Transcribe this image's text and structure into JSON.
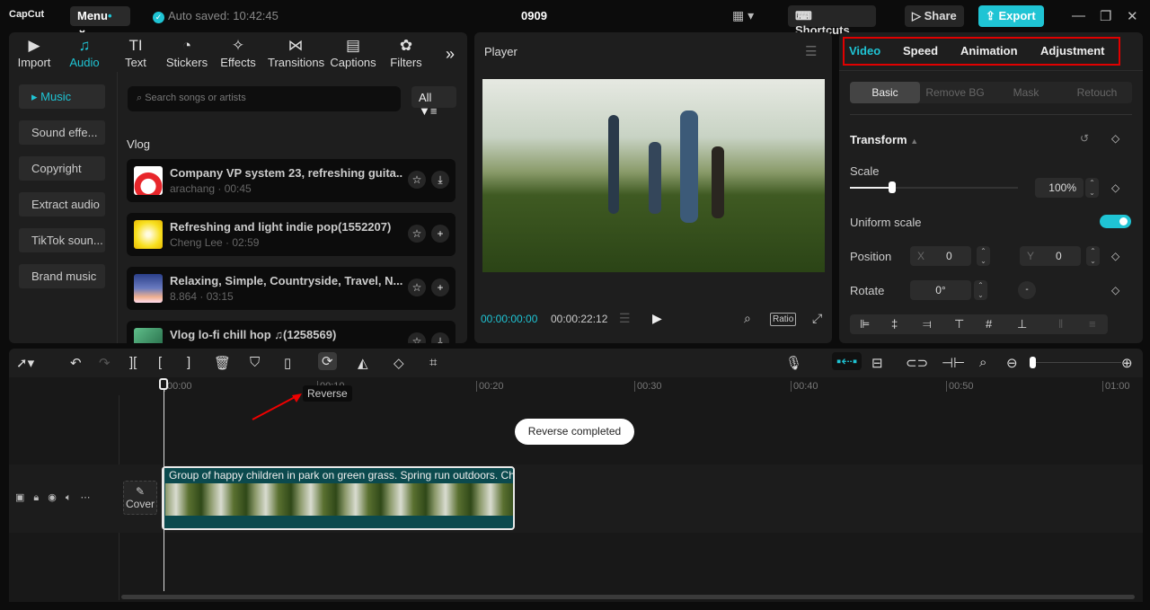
{
  "app": {
    "logo": "CapCut",
    "menu": "Menu",
    "autosave": "Auto saved: 10:42:45",
    "project": "0909",
    "shortcuts": "Shortcuts",
    "share": "Share",
    "export": "Export"
  },
  "media_tabs": [
    {
      "label": "Import",
      "icon": "▶"
    },
    {
      "label": "Audio",
      "icon": "♫"
    },
    {
      "label": "Text",
      "icon": "TI"
    },
    {
      "label": "Stickers",
      "icon": "◔"
    },
    {
      "label": "Effects",
      "icon": "✧"
    },
    {
      "label": "Transitions",
      "icon": "⋈"
    },
    {
      "label": "Captions",
      "icon": "▤"
    },
    {
      "label": "Filters",
      "icon": "✿"
    }
  ],
  "audio_sidebar": [
    "Music",
    "Sound effe...",
    "Copyright",
    "Extract audio",
    "TikTok soun...",
    "Brand music"
  ],
  "search": {
    "placeholder": "Search songs or artists",
    "filter": "All"
  },
  "section": "Vlog",
  "songs": [
    {
      "title": "Company VP system 23, refreshing guita...",
      "sub": "arachang · 00:45",
      "action": "download"
    },
    {
      "title": "Refreshing and light indie pop(1552207)",
      "sub": "Cheng Lee · 02:59",
      "action": "add"
    },
    {
      "title": "Relaxing, Simple, Countryside, Travel, N...",
      "sub": "8.864 · 03:15",
      "action": "add"
    },
    {
      "title": "Vlog  lo-fi chill hop ♫(1258569)",
      "sub": "",
      "action": "download"
    }
  ],
  "player": {
    "title": "Player",
    "current": "00:00:00:00",
    "total": "00:00:22:12",
    "ratio": "Ratio"
  },
  "inspector": {
    "tabs": [
      "Video",
      "Speed",
      "Animation",
      "Adjustment"
    ],
    "subtabs": [
      "Basic",
      "Remove BG",
      "Mask",
      "Retouch"
    ],
    "transform": "Transform",
    "scale_label": "Scale",
    "scale": "100%",
    "scale_value": 100,
    "uniform": "Uniform scale",
    "uniform_on": true,
    "position": "Position",
    "x_label": "X",
    "x": "0",
    "y_label": "Y",
    "y": "0",
    "rotate": "Rotate",
    "rotate_val": "0°"
  },
  "timeline": {
    "ticks": [
      "00:00",
      "00:10",
      "00:20",
      "00:30",
      "00:40",
      "00:50",
      "01:00"
    ],
    "tooltip": "Reverse",
    "toast": "Reverse completed",
    "clip_title": "Group of happy children in park on green grass. Spring run outdoors. Children",
    "cover": "Cover"
  }
}
